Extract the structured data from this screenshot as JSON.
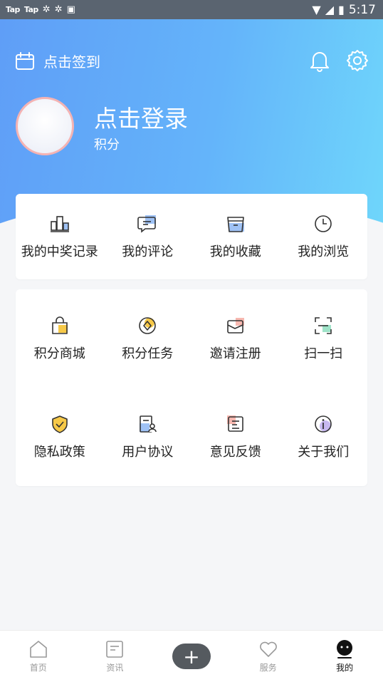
{
  "status_bar": {
    "apps": [
      "Tap",
      "Tap"
    ],
    "time": "5:17"
  },
  "header": {
    "signin_label": "点击签到",
    "login_title": "点击登录",
    "points_label": "积分"
  },
  "quick_menu": [
    {
      "label": "我的中奖记录",
      "icon": "trophy-icon"
    },
    {
      "label": "我的评论",
      "icon": "comment-icon"
    },
    {
      "label": "我的收藏",
      "icon": "favorites-icon"
    },
    {
      "label": "我的浏览",
      "icon": "history-clock-icon"
    }
  ],
  "service_menu": [
    {
      "label": "积分商城",
      "icon": "shopping-bag-icon"
    },
    {
      "label": "积分任务",
      "icon": "task-icon"
    },
    {
      "label": "邀请注册",
      "icon": "invite-mail-icon"
    },
    {
      "label": "扫一扫",
      "icon": "scan-icon"
    },
    {
      "label": "隐私政策",
      "icon": "shield-check-icon"
    },
    {
      "label": "用户协议",
      "icon": "agreement-icon"
    },
    {
      "label": "意见反馈",
      "icon": "feedback-icon"
    },
    {
      "label": "关于我们",
      "icon": "info-icon"
    }
  ],
  "bottom_nav": {
    "home": "首页",
    "news": "资讯",
    "service": "服务",
    "mine": "我的"
  },
  "colors": {
    "header_start": "#5f9ef7",
    "header_end": "#6fd6fb",
    "accent_yellow": "#f7c948",
    "accent_pink": "#f7b8b0",
    "accent_blue": "#9fc2f5",
    "accent_green": "#9fe3c8"
  }
}
